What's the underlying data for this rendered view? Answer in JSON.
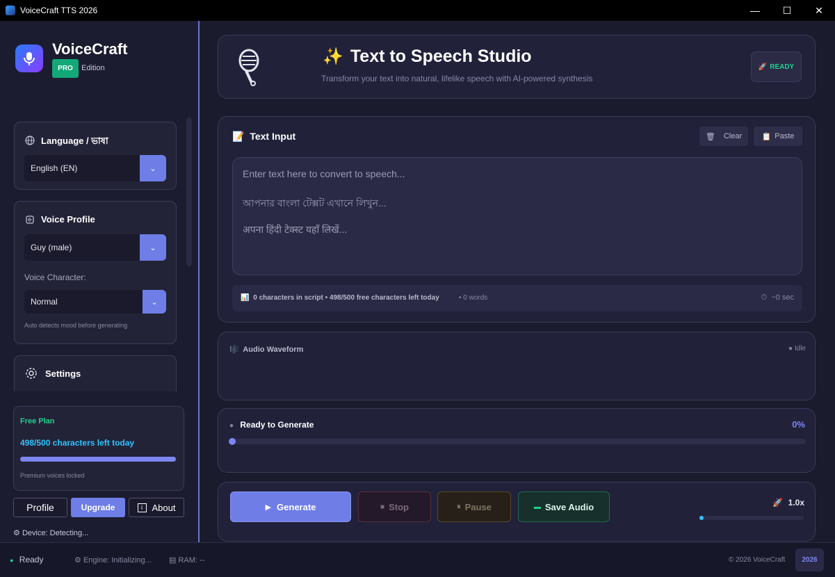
{
  "window": {
    "title": "VoiceCraft TTS 2026",
    "controls": {
      "minimize": "—",
      "maximize": "☐",
      "close": "✕"
    }
  },
  "sidebar": {
    "brand": {
      "name": "VoiceCraft",
      "badge": "PRO",
      "edition": "Edition"
    },
    "language": {
      "title": "Language / ভাষা",
      "icon": "globe-icon",
      "selected": "English (EN)"
    },
    "voice_profile": {
      "title": "Voice Profile",
      "icon": "voice-profile-icon",
      "selected": "Guy (male)",
      "character_label": "Voice Character:",
      "character_selected": "Normal",
      "hint": "Auto detects mood before generating"
    },
    "settings": {
      "title": "Settings",
      "icon": "gear-icon"
    },
    "plan": {
      "title": "Free Plan",
      "remaining": "498/500 characters left today",
      "usage_fraction": 0.996,
      "note": "Premium voices locked"
    },
    "buttons": {
      "profile": "Profile",
      "upgrade": "Upgrade",
      "about": "About",
      "about_glyph": "i"
    },
    "device": "Device: Detecting..."
  },
  "header": {
    "title": "Text to Speech Studio",
    "subtitle": "Transform your text into natural, lifelike speech with AI-powered synthesis",
    "status": "READY"
  },
  "input": {
    "title": "Text Input",
    "clear": "Clear",
    "paste": "Paste",
    "placeholder_lines": [
      "Enter text here to convert to speech...",
      "আপনার বাংলা টেক্সট এখানে লিখুন...",
      "अपना हिंदी टेक्स्ट यहाँ लिखें..."
    ],
    "chars_stat": "0 characters in script • 498/500 free characters left today",
    "words_stat": "• 0 words",
    "duration": "~0 sec"
  },
  "waveform": {
    "title": "Audio Waveform",
    "status": "Idle"
  },
  "progress": {
    "title": "Ready to Generate",
    "percent": "0%",
    "value": 0
  },
  "actions": {
    "generate": "Generate",
    "stop": "Stop",
    "pause": "Pause",
    "save": "Save Audio",
    "speed": "1.0x"
  },
  "statusbar": {
    "ready": "Ready",
    "engine": "Engine: Initializing...",
    "ram": "RAM: --",
    "copyright": "© 2026 VoiceCraft",
    "year": "2026"
  },
  "colors": {
    "accent": "#6e7ee6",
    "success": "#1fd18f",
    "info": "#2fc3ff",
    "sidebar_border": "#6a72d9"
  }
}
